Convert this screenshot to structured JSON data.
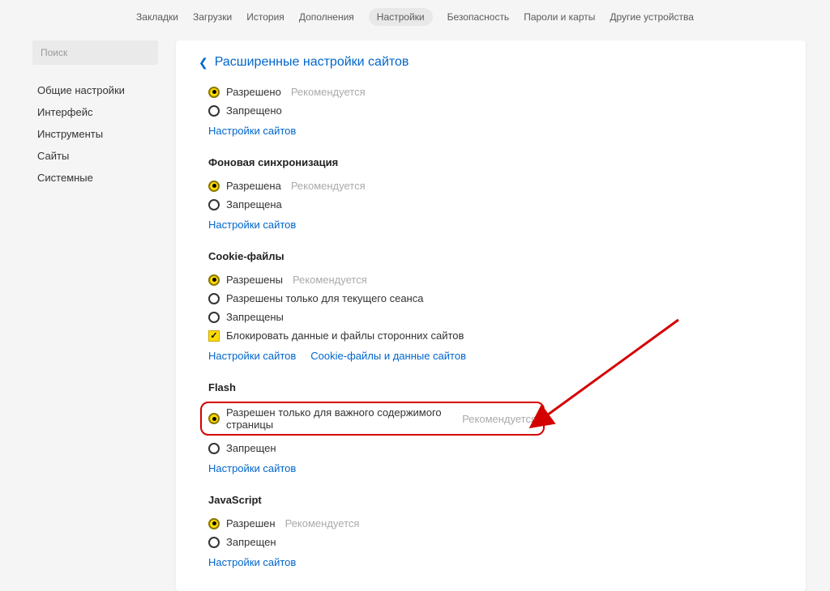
{
  "topTabs": {
    "t0": "Закладки",
    "t1": "Загрузки",
    "t2": "История",
    "t3": "Дополнения",
    "t4": "Настройки",
    "t5": "Безопасность",
    "t6": "Пароли и карты",
    "t7": "Другие устройства"
  },
  "sidebar": {
    "searchPlaceholder": "Поиск",
    "items": {
      "s0": "Общие настройки",
      "s1": "Интерфейс",
      "s2": "Инструменты",
      "s3": "Сайты",
      "s4": "Системные"
    }
  },
  "header": {
    "title": "Расширенные настройки сайтов"
  },
  "text": {
    "recommended": "Рекомендуется",
    "siteSettings": "Настройки сайтов"
  },
  "sec1": {
    "optAllowed": "Разрешено",
    "optDenied": "Запрещено"
  },
  "sec2": {
    "title": "Фоновая синхронизация",
    "optAllowed": "Разрешена",
    "optDenied": "Запрещена"
  },
  "sec3": {
    "title": "Cookie-файлы",
    "optAllowed": "Разрешены",
    "optSession": "Разрешены только для текущего сеанса",
    "optDenied": "Запрещены",
    "optBlock3rd": "Блокировать данные и файлы сторонних сайтов",
    "linkCookie": "Cookie-файлы и данные сайтов"
  },
  "sec4": {
    "title": "Flash",
    "optImportant": "Разрешен только для важного содержимого страницы",
    "optDenied": "Запрещен"
  },
  "sec5": {
    "title": "JavaScript",
    "optAllowed": "Разрешен",
    "optDenied": "Запрещен"
  }
}
